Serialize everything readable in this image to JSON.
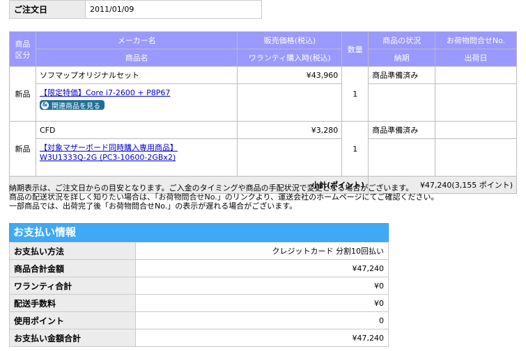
{
  "order": {
    "date_label": "ご注文日",
    "date_value": "2011/01/09"
  },
  "items_table": {
    "headers": {
      "category": "商品区分",
      "maker": "メーカー名",
      "product": "商品名",
      "price": "販売価格(税込)",
      "warranty": "ワランティ購入時(税込)",
      "qty": "数量",
      "status": "商品の状況",
      "delivery": "納期",
      "tracking": "お荷物問合せNo.",
      "ship_date": "出荷日"
    },
    "items": [
      {
        "category": "新品",
        "maker": "ソフマップオリジナルセット",
        "price": "¥43,960",
        "product": "【限定特価】Core i7-2600 + P8P67",
        "related_button": "関連商品を見る",
        "qty": "1",
        "status": "商品準備済み"
      },
      {
        "category": "新品",
        "maker": "CFD",
        "price": "¥3,280",
        "product_line1": "【対象マザーボード同時購入専用商品】",
        "product_line2": "W3U1333Q-2G (PC3-10600-2GBx2)",
        "qty": "1",
        "status": "商品準備済み"
      }
    ],
    "subtotal_label": "小計(ポイント)",
    "subtotal_value": "¥47,240(3,155 ポイント)"
  },
  "notes": [
    "納期表示は、ご注文日からの目安となります。ご入金のタイミングや商品の手配状況で変更となる場合がございます。",
    "商品の配送状況を詳しく知りたい場合は、「お荷物問合せNo.」のリンクより、運送会社のホームページにてご確認ください。",
    "一部商品では、出荷完了後「お荷物問合せNo.」の表示が遅れる場合がございます。"
  ],
  "payment": {
    "title": "お支払い情報",
    "rows": [
      {
        "label": "お支払い方法",
        "value": "クレジットカード 分割10回払い"
      },
      {
        "label": "商品合計金額",
        "value": "¥47,240"
      },
      {
        "label": "ワランティ合計",
        "value": "¥0"
      },
      {
        "label": "配送手数料",
        "value": "¥0"
      },
      {
        "label": "使用ポイント",
        "value": "0"
      },
      {
        "label": "お支払い金額合計",
        "value": "¥47,240"
      }
    ]
  }
}
